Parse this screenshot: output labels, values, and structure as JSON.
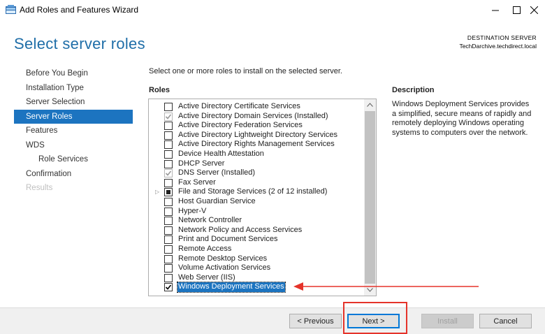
{
  "window": {
    "title": "Add Roles and Features Wizard",
    "controls": {
      "minimize": "minimize-icon",
      "maximize": "maximize-icon",
      "close": "close-icon"
    }
  },
  "page": {
    "title": "Select server roles",
    "destination_label": "DESTINATION SERVER",
    "destination_server": "TechDarchive.techdirect.local"
  },
  "nav": {
    "items": [
      {
        "label": "Before You Begin",
        "state": "normal",
        "sub": false
      },
      {
        "label": "Installation Type",
        "state": "normal",
        "sub": false
      },
      {
        "label": "Server Selection",
        "state": "normal",
        "sub": false
      },
      {
        "label": "Server Roles",
        "state": "active",
        "sub": false
      },
      {
        "label": "Features",
        "state": "normal",
        "sub": false
      },
      {
        "label": "WDS",
        "state": "normal",
        "sub": false
      },
      {
        "label": "Role Services",
        "state": "normal",
        "sub": true
      },
      {
        "label": "Confirmation",
        "state": "normal",
        "sub": false
      },
      {
        "label": "Results",
        "state": "disabled",
        "sub": false
      }
    ]
  },
  "main": {
    "instruction": "Select one or more roles to install on the selected server.",
    "roles_header": "Roles",
    "description_header": "Description",
    "description_text": "Windows Deployment Services provides a simplified, secure means of rapidly and remotely deploying Windows operating systems to computers over the network.",
    "roles": [
      {
        "label": "Active Directory Certificate Services",
        "state": "unchecked"
      },
      {
        "label": "Active Directory Domain Services (Installed)",
        "state": "checked-disabled"
      },
      {
        "label": "Active Directory Federation Services",
        "state": "unchecked"
      },
      {
        "label": "Active Directory Lightweight Directory Services",
        "state": "unchecked"
      },
      {
        "label": "Active Directory Rights Management Services",
        "state": "unchecked"
      },
      {
        "label": "Device Health Attestation",
        "state": "unchecked"
      },
      {
        "label": "DHCP Server",
        "state": "unchecked"
      },
      {
        "label": "DNS Server (Installed)",
        "state": "checked-disabled"
      },
      {
        "label": "Fax Server",
        "state": "unchecked"
      },
      {
        "label": "File and Storage Services (2 of 12 installed)",
        "state": "partial",
        "expandable": true
      },
      {
        "label": "Host Guardian Service",
        "state": "unchecked"
      },
      {
        "label": "Hyper-V",
        "state": "unchecked"
      },
      {
        "label": "Network Controller",
        "state": "unchecked"
      },
      {
        "label": "Network Policy and Access Services",
        "state": "unchecked"
      },
      {
        "label": "Print and Document Services",
        "state": "unchecked"
      },
      {
        "label": "Remote Access",
        "state": "unchecked"
      },
      {
        "label": "Remote Desktop Services",
        "state": "unchecked"
      },
      {
        "label": "Volume Activation Services",
        "state": "unchecked"
      },
      {
        "label": "Web Server (IIS)",
        "state": "unchecked"
      },
      {
        "label": "Windows Deployment Services",
        "state": "checked",
        "selected": true
      }
    ]
  },
  "buttons": {
    "previous": "< Previous",
    "next": "Next >",
    "install": "Install",
    "cancel": "Cancel"
  },
  "colors": {
    "accent": "#1c74c0",
    "title": "#1f6ea8",
    "annotation": "#e5332a"
  }
}
